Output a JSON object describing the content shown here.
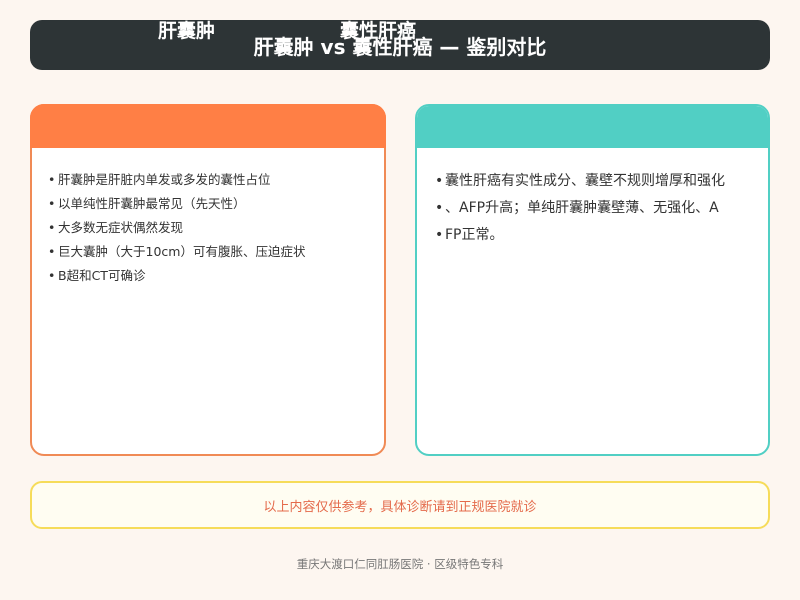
{
  "title": "肝囊肿 vs 囊性肝癌 — 鉴别对比",
  "left_card": {
    "heading": "肝囊肿",
    "accent": "#ff7f45",
    "items": [
      "肝囊肿是肝脏内单发或多发的囊性占位",
      "以单纯性肝囊肿最常见（先天性）",
      "大多数无症状偶然发现",
      "巨大囊肿（大于10cm）可有腹胀、压迫症状",
      "B超和CT可确诊"
    ]
  },
  "right_card": {
    "heading": "囊性肝癌",
    "accent": "#51cfc4",
    "items": [
      "囊性肝癌有实性成分、囊壁不规则增厚和强化",
      "、AFP升高；单纯肝囊肿囊壁薄、无强化、A",
      "FP正常。"
    ]
  },
  "bullet": "•",
  "note": "以上内容仅供参考，具体诊断请到正规医院就诊",
  "credit": "重庆大渡口仁同肛肠医院 · 区级特色专科",
  "colors": {
    "title_bg": "#2d3436",
    "note_border": "#f6dc5a",
    "note_text": "#e46a4b"
  }
}
